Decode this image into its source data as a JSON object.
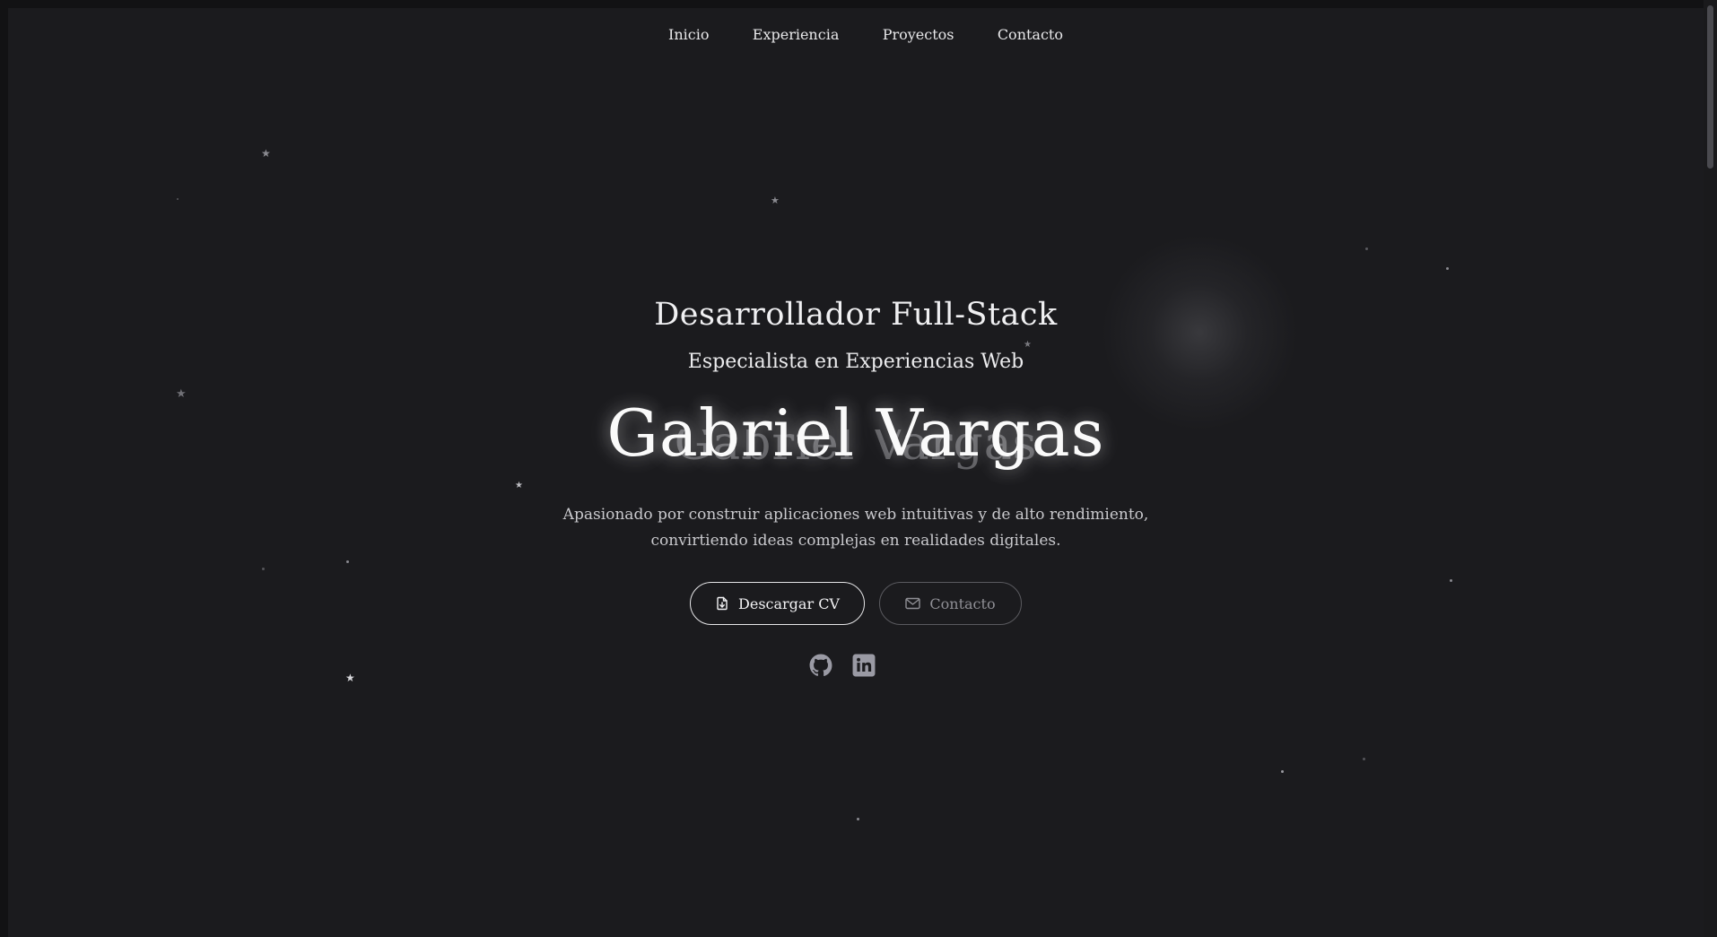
{
  "nav": {
    "items": [
      "Inicio",
      "Experiencia",
      "Proyectos",
      "Contacto"
    ]
  },
  "hero": {
    "role": "Desarrollador Full-Stack",
    "specialty": "Especialista en Experiencias Web",
    "name": "Gabriel Vargas",
    "description_line1": "Apasionado por construir aplicaciones web intuitivas y de alto rendimiento,",
    "description_line2": "convirtiendo ideas complejas en realidades digitales."
  },
  "actions": {
    "download_cv_label": "Descargar CV",
    "contact_label": "Contacto"
  },
  "social": {
    "github_icon": "github-icon",
    "linkedin_icon": "linkedin-icon"
  },
  "colors": {
    "background": "#1b1b1e",
    "text": "#e8e8ea",
    "muted": "#8f8f95"
  }
}
